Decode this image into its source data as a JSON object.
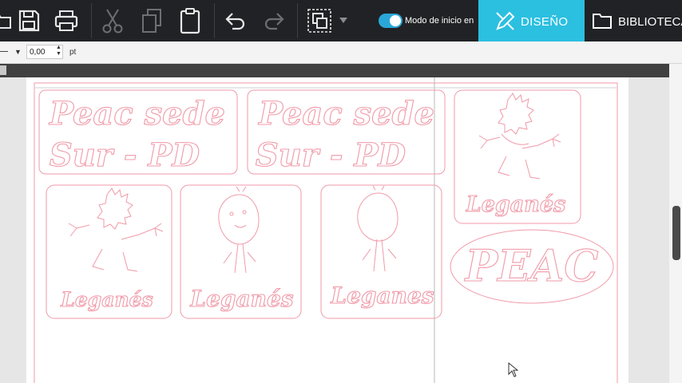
{
  "toolbar": {
    "tools": [
      "open-icon",
      "save-icon",
      "print-icon",
      "cut-icon",
      "copy-icon",
      "paste-icon",
      "undo-icon",
      "redo-icon",
      "group-icon",
      "chevron-down-icon"
    ],
    "mode_label": "Modo de inicio en",
    "design_tab": "DISEÑO",
    "library_tab": "BIBLIOTECA",
    "accent": "#2bbfe0"
  },
  "properties": {
    "line_width_value": "0,00",
    "unit": "pt"
  },
  "design": {
    "sign_peac_sede_line1": "Peac sede",
    "sign_peac_sede_line2": "Sur - PD",
    "leganes_label_1": "Leganés",
    "leganes_label_2": "Leganés",
    "leganes_label_3": "Leganés",
    "leganes_label_4": "Leganes",
    "peac_oval_text": "PEAC",
    "cut_line_color": "#f09aa8"
  }
}
